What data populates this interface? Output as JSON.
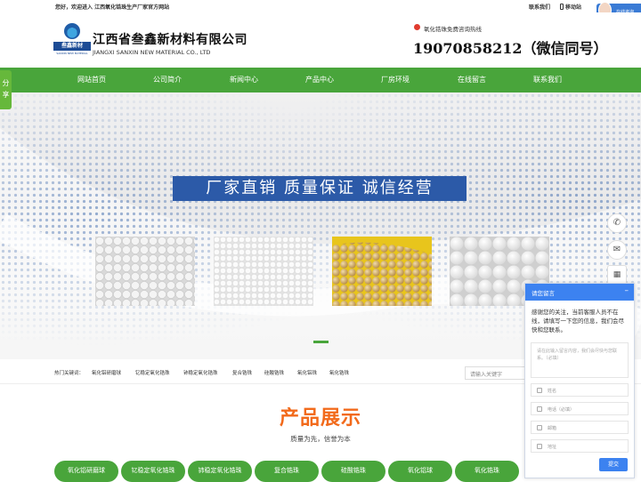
{
  "topbar": {
    "welcome": "您好，欢迎进入 江西氧化锆珠生产厂家官方网站",
    "contact": "联系我们",
    "mobile": "移动站",
    "online_consult": "在线咨询"
  },
  "header": {
    "logo_text": "叁鑫新材",
    "logo_sub": "SANXIN NEW MATERIAL",
    "company_cn": "江西省叁鑫新材料有限公司",
    "company_en": "JIANGXI SANXIN NEW MATERIAL CO., LTD",
    "hotline_label": "氧化锆珠免费咨询热线",
    "hotline_number": "19070858212（微信同号）"
  },
  "nav": {
    "items": [
      "网站首页",
      "公司简介",
      "新闻中心",
      "产品中心",
      "厂房环境",
      "在线留言",
      "联系我们"
    ]
  },
  "share": "分享",
  "banner": {
    "slogan": "厂家直销  质量保证  诚信经营"
  },
  "keywords": {
    "label": "热门关键词：",
    "items": [
      "氧化铝研磨球",
      "钇稳定氧化锆珠",
      "铈稳定氧化锆珠",
      "复合锆珠",
      "硅酸锆珠",
      "氧化铝珠",
      "氧化锆珠"
    ],
    "search_placeholder": "请输入关键字"
  },
  "products": {
    "title": "产品展示",
    "subtitle": "质量为先，信誉为本",
    "categories": [
      "氧化铝研磨球",
      "钇稳定氧化锆珠",
      "铈稳定氧化锆珠",
      "复合锆珠",
      "硅酸锆珠",
      "氧化铝球",
      "氧化锆珠"
    ]
  },
  "message": {
    "title": "请您留言",
    "intro": "感谢您的关注，当前客服人员不在线，请填写一下您的信息，我们会尽快和您联系。",
    "content_placeholder": "请在此输入留言内容，我们会尽快与您联系。（必填）",
    "name_placeholder": "姓名",
    "phone_placeholder": "电话（必填）",
    "email_placeholder": "邮箱",
    "address_placeholder": "地址",
    "submit": "提交"
  },
  "colors": {
    "nav_green": "#49a53b",
    "slogan_blue": "#2c5aa8",
    "title_orange": "#f26a1b",
    "panel_blue": "#3c82f0"
  }
}
